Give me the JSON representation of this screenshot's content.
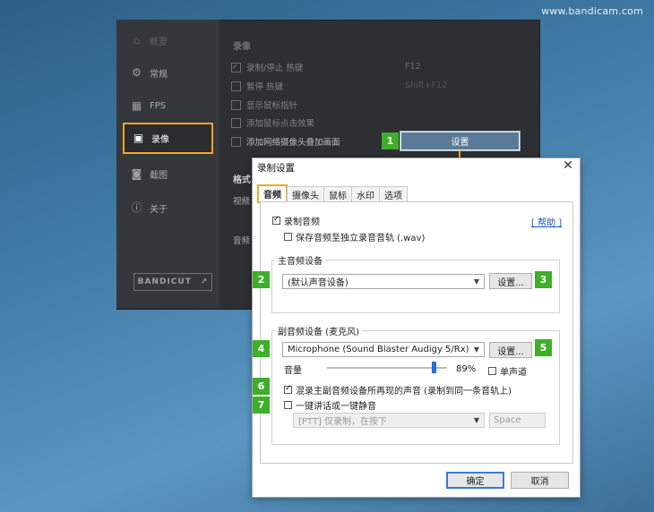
{
  "watermark": "www.bandicam.com",
  "bg": {
    "sidebar": [
      {
        "label": "概要",
        "icon": "home-icon"
      },
      {
        "label": "常规",
        "icon": "gear-icon"
      },
      {
        "label": "FPS",
        "icon": "fps-icon"
      },
      {
        "label": "录像",
        "icon": "video-record-icon"
      },
      {
        "label": "截图",
        "icon": "camera-icon"
      },
      {
        "label": "关于",
        "icon": "info-icon"
      }
    ],
    "bandicut_label": "BANDICUT",
    "section_title": "录像",
    "options": [
      {
        "label": "录制/停止 热键",
        "key": "F12",
        "checked": true
      },
      {
        "label": "暂停 热键",
        "key": "Shift+F12",
        "checked": false
      },
      {
        "label": "显示鼠标指针",
        "key": "",
        "checked": false
      },
      {
        "label": "添加鼠标点击效果",
        "key": "",
        "checked": false
      },
      {
        "label": "添加网络摄像头叠加画面",
        "key": "",
        "checked": false
      }
    ],
    "format_label": "格式",
    "video_label": "视频",
    "audio_label": "音频",
    "settings_button": "设置"
  },
  "badges": [
    "1",
    "2",
    "3",
    "4",
    "5",
    "6",
    "7"
  ],
  "dialog": {
    "title": "录制设置",
    "close": "✕",
    "tabs": [
      "音频",
      "摄像头",
      "鼠标",
      "水印",
      "选项"
    ],
    "record_audio": "录制音频",
    "save_separate": "保存音频至独立录音音轨 (.wav)",
    "help": "[ 帮助 ]",
    "primary_group": "主音频设备",
    "primary_device": "(默认声音设备)",
    "primary_settings": "设置...",
    "secondary_group": "副音频设备 (麦克风)",
    "secondary_device": "Microphone (Sound Blaster Audigy 5/Rx)",
    "secondary_settings": "设置...",
    "volume_label": "音量",
    "volume_value": "89%",
    "volume_level": 0.89,
    "mono_label": "单声道",
    "mix_label": "混录主副音频设备所再现的声音 (录制到同一条音轨上)",
    "ptt_label": "一键讲话或一键静音",
    "ptt_mode": "[PTT] 仅录制，在按下",
    "ptt_key": "Space",
    "ok": "确定",
    "cancel": "取消"
  }
}
